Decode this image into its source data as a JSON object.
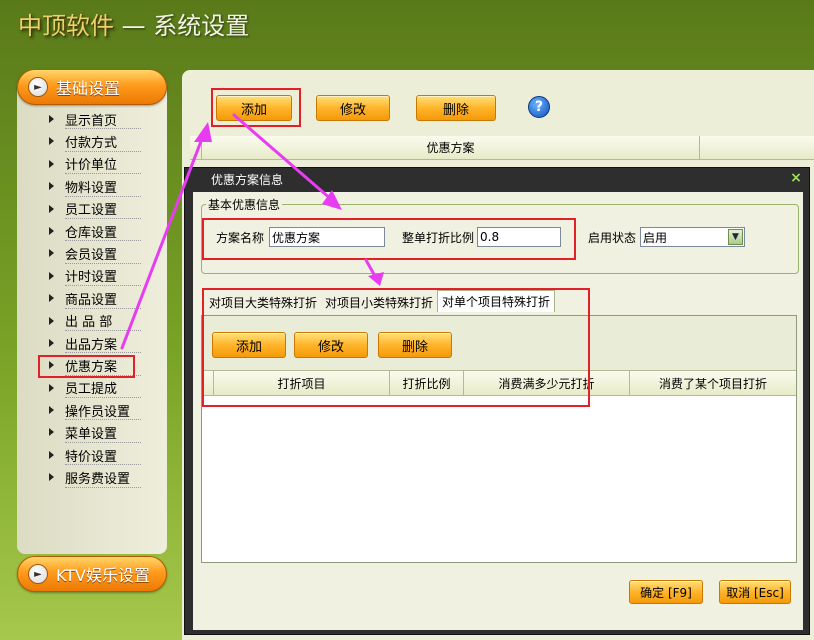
{
  "window": {
    "brand": "中顶软件",
    "title_suffix": " — 系统设置"
  },
  "sidebar": {
    "header_label": "基础设置",
    "items": [
      {
        "label": "显示首页"
      },
      {
        "label": "付款方式"
      },
      {
        "label": "计价单位"
      },
      {
        "label": "物料设置"
      },
      {
        "label": "员工设置"
      },
      {
        "label": "仓库设置"
      },
      {
        "label": "会员设置"
      },
      {
        "label": "计时设置"
      },
      {
        "label": "商品设置"
      },
      {
        "label": "出 品 部"
      },
      {
        "label": "出品方案"
      },
      {
        "label": "优惠方案"
      },
      {
        "label": "员工提成"
      },
      {
        "label": "操作员设置"
      },
      {
        "label": "菜单设置"
      },
      {
        "label": "特价设置"
      },
      {
        "label": "服务费设置"
      }
    ],
    "selected_item": "优惠方案",
    "footer_label": "KTV娱乐设置"
  },
  "toolbar": {
    "add_label": "添加",
    "edit_label": "修改",
    "delete_label": "删除",
    "help_label": "?"
  },
  "main_grid": {
    "columns": [
      "",
      "优惠方案",
      ""
    ]
  },
  "dialog": {
    "title": "优惠方案信息",
    "close_label": "×",
    "basic_group": {
      "title": "基本优惠信息",
      "scheme_name_label": "方案名称",
      "scheme_name_value": "优惠方案",
      "discount_ratio_label": "整单打折比例",
      "discount_ratio_value": "0.8",
      "status_label": "启用状态",
      "status_value": "启用"
    },
    "tabs": [
      {
        "label": "对项目大类特殊打折"
      },
      {
        "label": "对项目小类特殊打折"
      },
      {
        "label": "对单个项目特殊打折"
      }
    ],
    "active_tab": "对单个项目特殊打折",
    "sub_toolbar": {
      "add_label": "添加",
      "edit_label": "修改",
      "delete_label": "删除"
    },
    "sub_grid_columns": [
      "",
      "打折项目",
      "打折比例",
      "消费满多少元打折",
      "消费了某个项目打折"
    ],
    "confirm_label": "确定 [F9]",
    "cancel_label": "取消 [Esc]"
  },
  "colors": {
    "highlight": "#e32027",
    "annotation_arrow": "#e83cf2",
    "accent_orange": "#ff9a1c"
  }
}
